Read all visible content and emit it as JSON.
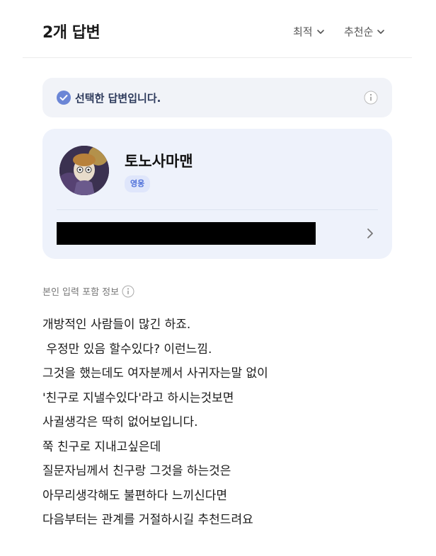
{
  "header": {
    "answer_count": "2개 답변",
    "sort_latest": "최적",
    "sort_recommend": "추천순"
  },
  "banner": {
    "text": "선택한 답변입니다."
  },
  "profile": {
    "username": "토노사마맨",
    "rank": "영웅"
  },
  "meta": {
    "label": "본인 입력 포함 정보"
  },
  "answer": {
    "lines": [
      "개방적인 사람들이 많긴 하죠.",
      " 우정만 있음 할수있다? 이런느낌.",
      "그것을 했는데도 여자분께서 사귀자는말 없이",
      "'친구로 지낼수있다'라고 하시는것보면",
      "사귈생각은 딱히 없어보입니다.",
      "쭉 친구로 지내고싶은데",
      "질문자님께서 친구랑 그것을 하는것은",
      "아무리생각해도 불편하다 느끼신다면",
      "다음부터는 관계를 거절하시길 추천드려요"
    ]
  },
  "colors": {
    "banner_bg": "#f1f3f8",
    "card_bg": "#eef2fb",
    "badge_text": "#4d6fd9",
    "check_icon": "#6b86d6"
  },
  "icons": {
    "check": "check-circle-icon",
    "info": "info-icon",
    "chevron_down": "chevron-down-icon",
    "chevron_right": "chevron-right-icon"
  }
}
